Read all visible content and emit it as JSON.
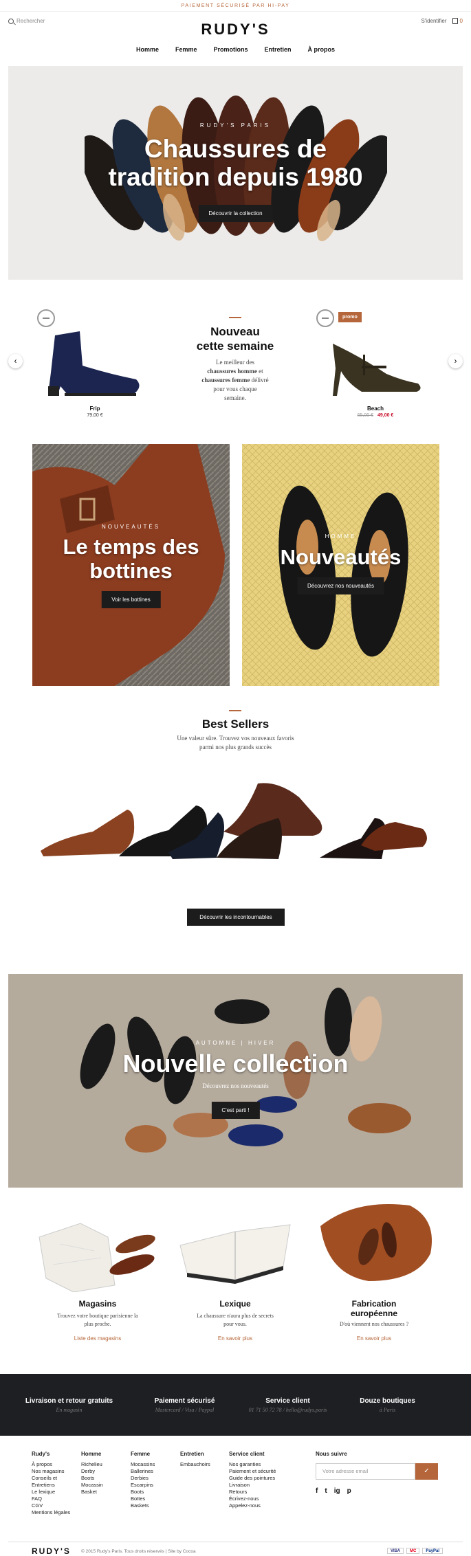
{
  "topbar": {
    "text": "Paiement sécurisé par Hi-Pay"
  },
  "header": {
    "search_label": "Rechercher",
    "logo": "RUDY'S",
    "account_label": "S'identifier",
    "cart_count": "0",
    "nav": [
      "Homme",
      "Femme",
      "Promotions",
      "Entretien",
      "À propos"
    ]
  },
  "hero": {
    "kicker": "RUDY'S PARIS",
    "title_line1": "Chaussures de",
    "title_line2": "tradition depuis 1980",
    "cta": "Découvrir la collection"
  },
  "new_section": {
    "title_line1": "Nouveau",
    "title_line2": "cette semaine",
    "desc_1": "Le meilleur des",
    "desc_bold_1": "chaussures homme",
    "desc_2": "et",
    "desc_bold_2": "chaussures femme",
    "desc_3": "délivré",
    "desc_4": "pour vous chaque",
    "desc_5": "semaine.",
    "prev": "‹",
    "next": "›",
    "products": [
      {
        "name": "Frip",
        "price": "79,00 €"
      },
      {
        "name": "Beach",
        "old_price": "65,00 €",
        "price": "49,00 €",
        "tag": "promo"
      }
    ]
  },
  "tiles": [
    {
      "kicker": "NOUVEAUTÉS",
      "title_line1": "Le temps des",
      "title_line2": "bottines",
      "cta": "Voir les bottines"
    },
    {
      "kicker": "HOMME",
      "title_line1": "Nouveautés",
      "cta": "Découvrez nos nouveautés"
    }
  ],
  "bestsellers": {
    "title": "Best Sellers",
    "desc_line1": "Une valeur sûre. Trouvez vos nouveaux favoris",
    "desc_line2": "parmi nos plus grands succès",
    "cta": "Découvrir les incontournables"
  },
  "collection": {
    "kicker": "AUTOMNE | HIVER",
    "title": "Nouvelle collection",
    "subtitle": "Découvrez nos nouveautés",
    "cta": "C'est parti !"
  },
  "categories": [
    {
      "title": "Magasins",
      "desc_line1": "Trouvez votre boutique parisienne la",
      "desc_line2": "plus proche.",
      "link": "Liste des magasins"
    },
    {
      "title": "Lexique",
      "desc_line1": "La chaussure n'aura plus de secrets",
      "desc_line2": "pour vous.",
      "link": "En savoir plus"
    },
    {
      "title_line1": "Fabrication",
      "title_line2": "européenne",
      "desc_line1": "D'où viennent nos chaussures ?",
      "link": "En savoir plus"
    }
  ],
  "features": [
    {
      "title": "Livraison et retour gratuits",
      "sub": "En magasin"
    },
    {
      "title": "Paiement sécurisé",
      "sub": "Mastercard / Visa / Paypal"
    },
    {
      "title": "Service client",
      "sub": "01 71 50 72 78 / hello@rudys.paris"
    },
    {
      "title": "Douze boutiques",
      "sub": "à Paris"
    }
  ],
  "footer": {
    "columns": [
      {
        "title": "Rudy's",
        "items": [
          "À propos",
          "Nos magasins",
          "Conseils et Entretiens",
          "Le lexique",
          "FAQ",
          "CGV",
          "Mentions légales"
        ]
      },
      {
        "title": "Homme",
        "items": [
          "Richelieu",
          "Derby",
          "Boots",
          "Mocassin",
          "Basket"
        ]
      },
      {
        "title": "Femme",
        "items": [
          "Mocassins",
          "Ballerines",
          "Derbies",
          "Escarpins",
          "Boots",
          "Bottes",
          "Baskets"
        ]
      },
      {
        "title": "Entretien",
        "items": [
          "Embauchoirs"
        ]
      },
      {
        "title": "Service client",
        "items": [
          "Nos garanties",
          "Paiement et sécurité",
          "Guide des pointures",
          "Livraison",
          "Retours",
          "Écrivez-nous",
          "Appelez-nous"
        ]
      }
    ],
    "newsletter_title": "Nous suivre",
    "newsletter_placeholder": "Votre adresse email",
    "newsletter_submit": "✓",
    "social": [
      "f",
      "t",
      "ig",
      "p"
    ],
    "bottom_logo": "RUDY'S",
    "copyright": "© 2015 Rudy's Paris. Tous droits réservés | Site by Cocoa",
    "payments": [
      "VISA",
      "MC",
      "PayPal"
    ]
  },
  "colors": {
    "accent": "#b5663a",
    "dark": "#1c1c1c",
    "promo_red": "#c8102e"
  }
}
